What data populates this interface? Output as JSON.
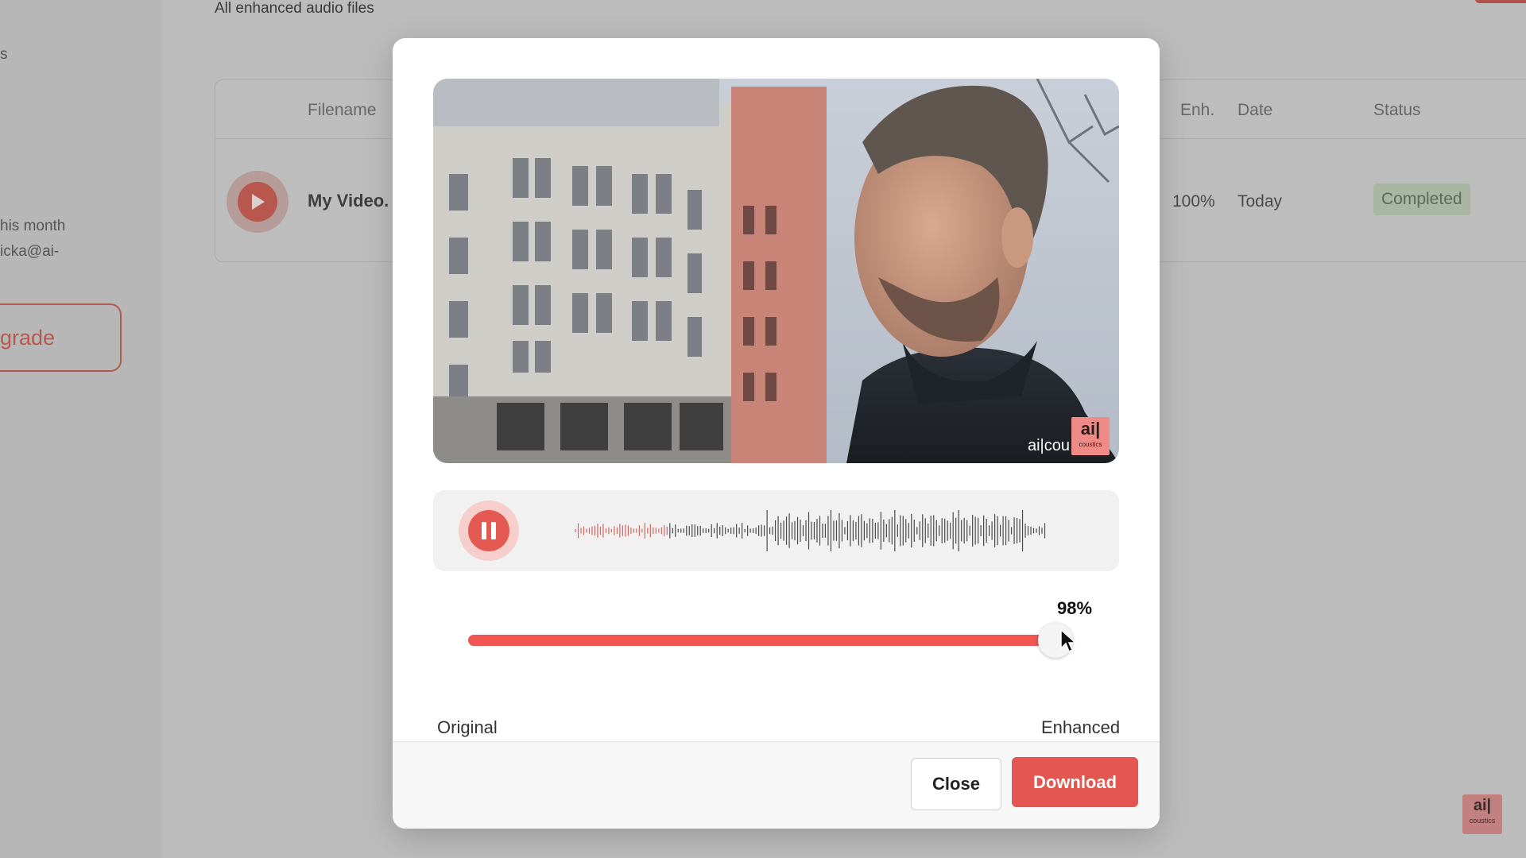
{
  "background": {
    "sidebar": {
      "top_fragment": "s",
      "usage_fragment": "his month",
      "email_fragment": "icka@ai-",
      "upgrade_label": "grade"
    },
    "page": {
      "subtitle": "All enhanced audio files"
    },
    "table": {
      "columns": [
        "Filename",
        "Enh.",
        "Date",
        "Status"
      ],
      "rows": [
        {
          "filename": "My Video.",
          "enhancement": "100%",
          "date": "Today",
          "status": "Completed"
        }
      ]
    },
    "corner_logo": {
      "big": "ai|",
      "small": "coustics"
    }
  },
  "modal": {
    "video": {
      "watermark_text": "ai|cou",
      "watermark_box_big": "ai|",
      "watermark_box_small": "coustics"
    },
    "player": {
      "state": "playing",
      "control_icon": "pause-icon"
    },
    "enhancement": {
      "value_label": "98%",
      "value": 0.98,
      "min_label": "Original",
      "max_label": "Enhanced"
    },
    "footer": {
      "close_label": "Close",
      "download_label": "Download"
    }
  },
  "colors": {
    "accent": "#e35750",
    "slider_fill": "#f05552",
    "status_badge_bg": "#a9b7a2"
  }
}
